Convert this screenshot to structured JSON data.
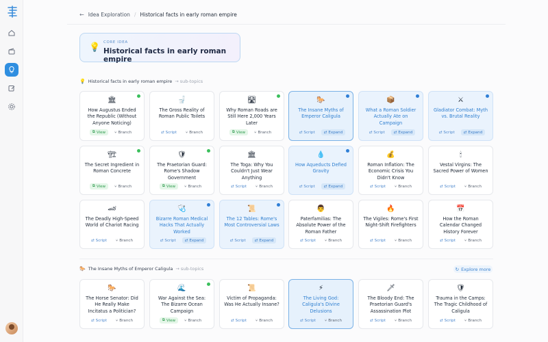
{
  "breadcrumb": {
    "parent": "Idea Exploration",
    "current": "Historical facts in early roman empire"
  },
  "core_idea": {
    "label": "CORE IDEA",
    "title": "Historical facts in early roman empire"
  },
  "sections": [
    {
      "title": "Historical facts in early roman empire",
      "suffix": "→ sub-topics"
    },
    {
      "title": "The Insane Myths of Emperor Caligula",
      "suffix": "→ sub-topics",
      "action": "Explore more"
    }
  ],
  "buttons": {
    "view": "View",
    "script": "Script",
    "branch": "Branch",
    "expand": "Expand"
  },
  "cards": [
    {
      "title": "How Augustus Ended the Republic (Without Anyone Noticing)",
      "icon": "🏛",
      "status": "green",
      "actions": [
        "view",
        "branch"
      ],
      "style": ""
    },
    {
      "title": "The Gross Reality of Roman Public Toilets",
      "icon": "🚽",
      "status": "",
      "actions": [
        "script",
        "branch"
      ],
      "style": ""
    },
    {
      "title": "Why Roman Roads are Still Here 2,000 Years Later",
      "icon": "🛣",
      "status": "green",
      "actions": [
        "view",
        "branch"
      ],
      "style": ""
    },
    {
      "title": "The Insane Myths of Emperor Caligula",
      "icon": "🐎",
      "status": "blue",
      "actions": [
        "script",
        "expand"
      ],
      "style": "sel"
    },
    {
      "title": "What a Roman Soldier Actually Ate on Campaign",
      "icon": "📦",
      "status": "blue",
      "actions": [
        "script",
        "expand"
      ],
      "style": "hl"
    },
    {
      "title": "Gladiator Combat: Myth vs. Brutal Reality",
      "icon": "⚔",
      "status": "blue",
      "actions": [
        "script",
        "expand"
      ],
      "style": "hl"
    },
    {
      "title": "The Secret Ingredient in Roman Concrete",
      "icon": "🏗",
      "status": "green",
      "actions": [
        "view",
        "branch"
      ],
      "style": ""
    },
    {
      "title": "The Praetorian Guard: Rome's Shadow Government",
      "icon": "🛡",
      "status": "green",
      "actions": [
        "view",
        "branch"
      ],
      "style": ""
    },
    {
      "title": "The Toga: Why You Couldn't Just Wear Anything",
      "icon": "🏛",
      "status": "",
      "actions": [
        "script",
        "branch"
      ],
      "style": ""
    },
    {
      "title": "How Aqueducts Defied Gravity",
      "icon": "💧",
      "status": "blue",
      "actions": [
        "script",
        "expand"
      ],
      "style": "hl"
    },
    {
      "title": "Roman Inflation: The Economic Crisis You Didn't Know",
      "icon": "💰",
      "status": "",
      "actions": [
        "script",
        "branch"
      ],
      "style": ""
    },
    {
      "title": "Vestal Virgins: The Sacred Power of Women",
      "icon": "🕯",
      "status": "",
      "actions": [
        "script",
        "branch"
      ],
      "style": ""
    },
    {
      "title": "The Deadly High-Speed World of Chariot Racing",
      "icon": "🏎",
      "status": "",
      "actions": [
        "script",
        "branch"
      ],
      "style": ""
    },
    {
      "title": "Bizarre Roman Medical Hacks That Actually Worked",
      "icon": "🩺",
      "status": "blue",
      "actions": [
        "script",
        "expand"
      ],
      "style": "hl"
    },
    {
      "title": "The 12 Tables: Rome's Most Controversial Laws",
      "icon": "📜",
      "status": "blue",
      "actions": [
        "script",
        "expand"
      ],
      "style": "hl"
    },
    {
      "title": "Paterfamilias: The Absolute Power of the Roman Father",
      "icon": "👨",
      "status": "",
      "actions": [
        "script",
        "branch"
      ],
      "style": ""
    },
    {
      "title": "The Vigiles: Rome's First Night-Shift Firefighters",
      "icon": "🔥",
      "status": "",
      "actions": [
        "script",
        "branch"
      ],
      "style": ""
    },
    {
      "title": "How the Roman Calendar Changed History Forever",
      "icon": "📅",
      "status": "",
      "actions": [
        "script",
        "branch"
      ],
      "style": ""
    },
    {
      "title": "The Horse Senator: Did He Really Make Incitatus a Politician?",
      "icon": "🐎",
      "status": "",
      "actions": [
        "script",
        "branch"
      ],
      "style": ""
    },
    {
      "title": "War Against the Sea: The Bizarre Ocean Campaign",
      "icon": "🌊",
      "status": "green",
      "actions": [
        "view",
        "branch"
      ],
      "style": ""
    },
    {
      "title": "Victim of Propaganda: Was He Actually Insane?",
      "icon": "📜",
      "status": "",
      "actions": [
        "script",
        "branch"
      ],
      "style": ""
    },
    {
      "title": "The Living God: Caligula's Divine Delusions",
      "icon": "⚡",
      "status": "",
      "actions": [
        "script",
        "branch"
      ],
      "style": "sel"
    },
    {
      "title": "The Bloody End: The Praetorian Guard's Assassination Plot",
      "icon": "🗡",
      "status": "",
      "actions": [
        "script",
        "branch"
      ],
      "style": ""
    },
    {
      "title": "Trauma in the Camps: The Tragic Childhood of Caligula",
      "icon": "🛡",
      "status": "",
      "actions": [
        "script",
        "branch"
      ],
      "style": ""
    }
  ]
}
